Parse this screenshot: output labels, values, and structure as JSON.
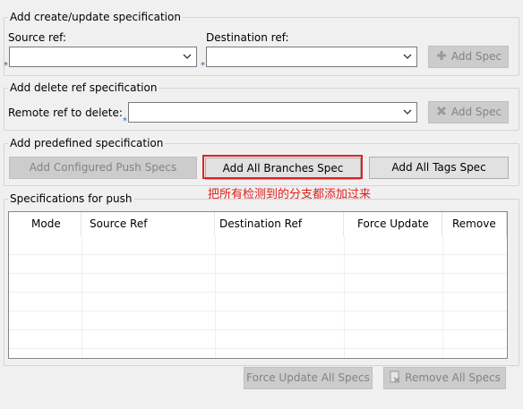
{
  "create_update": {
    "title": "Add create/update specification",
    "source_label": "Source ref:",
    "source_value": "",
    "destination_label": "Destination ref:",
    "destination_value": "",
    "add_spec_label": "Add Spec",
    "required_mark": "*"
  },
  "delete_ref": {
    "title": "Add delete ref specification",
    "remote_label": "Remote ref to delete:",
    "remote_value": "",
    "add_spec_label": "Add Spec",
    "required_mark": "*"
  },
  "predefined": {
    "title": "Add predefined specification",
    "configured_push_label": "Add Configured Push Specs",
    "all_branches_label": "Add All Branches Spec",
    "all_tags_label": "Add All Tags Spec"
  },
  "annotation": {
    "text": "把所有检测到的分支都添加过来",
    "color": "#e02020"
  },
  "specs": {
    "title": "Specifications for push",
    "columns": [
      "Mode",
      "Source Ref",
      "Destination Ref",
      "Force Update",
      "Remove"
    ],
    "rows": []
  },
  "footer": {
    "force_update_all_label": "Force Update All Specs",
    "remove_all_label": "Remove All Specs"
  },
  "icons": {
    "add": "plus-icon",
    "delete": "x-icon",
    "remove_all": "remove-document-icon",
    "dropdown": "chevron-down-icon"
  }
}
